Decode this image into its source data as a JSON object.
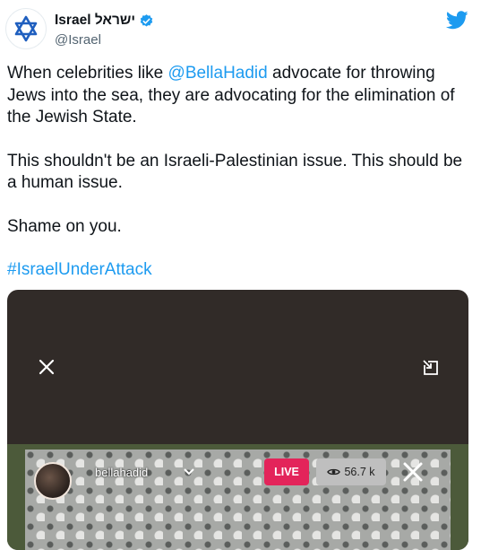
{
  "account": {
    "display_name": "Israel ישראל",
    "handle": "@Israel"
  },
  "icons": {
    "avatar": "star-of-david-icon",
    "verified": "verified-badge-icon",
    "brand": "twitter-bird-icon",
    "media_close": "close-icon",
    "media_expand": "picture-in-picture-icon"
  },
  "colors": {
    "link": "#1d9bf0",
    "live_badge": "#e3245a",
    "media_background": "#312b28"
  },
  "tweet": {
    "p1_pre": "When celebrities like ",
    "p1_mention": "@BellaHadid",
    "p1_post": " advocate for throwing Jews into the sea, they are advocating for the elimination of the Jewish State.",
    "p2": "This shouldn't be an Israeli-Palestinian issue. This should be a human issue.",
    "p3": "Shame on you.",
    "hashtag": "#IsraelUnderAttack"
  },
  "video": {
    "username": "bellahadid",
    "live_label": "LIVE",
    "viewer_count": "56.7 k"
  }
}
